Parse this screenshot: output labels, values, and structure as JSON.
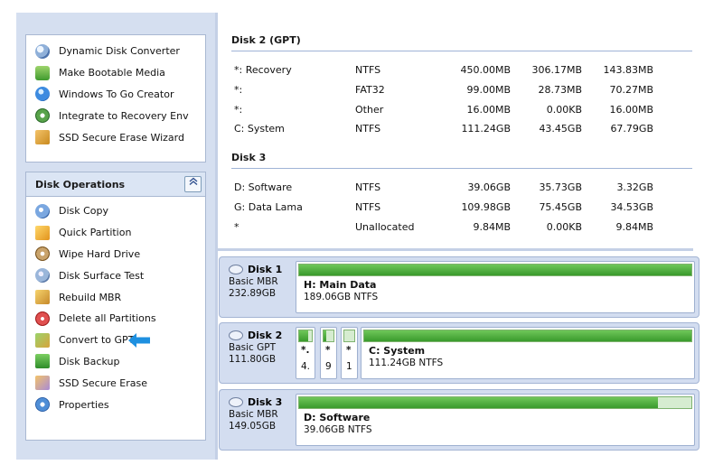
{
  "tools_panel": {
    "items": [
      {
        "label": "Dynamic Disk Converter",
        "icon": "disk-converter-icon"
      },
      {
        "label": "Make Bootable Media",
        "icon": "bootable-media-icon"
      },
      {
        "label": "Windows To Go Creator",
        "icon": "globe-icon"
      },
      {
        "label": "Integrate to Recovery Env",
        "icon": "recovery-gear-icon"
      },
      {
        "label": "SSD Secure Erase Wizard",
        "icon": "ssd-icon"
      }
    ]
  },
  "disk_operations": {
    "title": "Disk Operations",
    "collapse_glyph": "»",
    "items": [
      {
        "label": "Disk Copy",
        "icon": "disk-copy-icon"
      },
      {
        "label": "Quick Partition",
        "icon": "quick-partition-icon"
      },
      {
        "label": "Wipe Hard Drive",
        "icon": "wipe-drive-icon"
      },
      {
        "label": "Disk Surface Test",
        "icon": "surface-test-icon"
      },
      {
        "label": "Rebuild MBR",
        "icon": "rebuild-mbr-icon"
      },
      {
        "label": "Delete all Partitions",
        "icon": "delete-partitions-icon"
      },
      {
        "label": "Convert to GPT",
        "icon": "convert-gpt-icon"
      },
      {
        "label": "Disk Backup",
        "icon": "disk-backup-icon"
      },
      {
        "label": "SSD Secure Erase",
        "icon": "ssd-erase-icon"
      },
      {
        "label": "Properties",
        "icon": "properties-icon"
      }
    ],
    "highlight_arrow_color": "#1e90e0"
  },
  "partition_list": {
    "groups": [
      {
        "title": "Disk 2 (GPT)",
        "rows": [
          {
            "name": "*: Recovery",
            "fs": "NTFS",
            "capacity": "450.00MB",
            "used": "306.17MB",
            "free": "143.83MB"
          },
          {
            "name": "*:",
            "fs": "FAT32",
            "capacity": "99.00MB",
            "used": "28.73MB",
            "free": "70.27MB"
          },
          {
            "name": "*:",
            "fs": "Other",
            "capacity": "16.00MB",
            "used": "0.00KB",
            "free": "16.00MB"
          },
          {
            "name": "C: System",
            "fs": "NTFS",
            "capacity": "111.24GB",
            "used": "43.45GB",
            "free": "67.79GB"
          }
        ]
      },
      {
        "title": "Disk 3",
        "rows": [
          {
            "name": "D: Software",
            "fs": "NTFS",
            "capacity": "39.06GB",
            "used": "35.73GB",
            "free": "3.32GB"
          },
          {
            "name": "G: Data Lama",
            "fs": "NTFS",
            "capacity": "109.98GB",
            "used": "75.45GB",
            "free": "34.53GB"
          },
          {
            "name": "*",
            "fs": "Unallocated",
            "capacity": "9.84MB",
            "used": "0.00KB",
            "free": "9.84MB"
          }
        ]
      }
    ]
  },
  "disk_map": {
    "disks": [
      {
        "name": "Disk 1",
        "type": "Basic MBR",
        "size": "232.89GB",
        "partitions": [
          {
            "title": "H: Main Data",
            "detail": "189.06GB NTFS",
            "fill": 1.0
          }
        ]
      },
      {
        "name": "Disk 2",
        "type": "Basic GPT",
        "size": "111.80GB",
        "partitions": [
          {
            "title": "*.",
            "detail": "4.",
            "fill": 0.68,
            "mini": true
          },
          {
            "title": "*",
            "detail": "9",
            "fill": 0.29,
            "mini": true
          },
          {
            "title": "*",
            "detail": "1",
            "fill": 0.0,
            "mini": true
          },
          {
            "title": "C: System",
            "detail": "111.24GB NTFS",
            "fill": 1.0
          }
        ]
      },
      {
        "name": "Disk 3",
        "type": "Basic MBR",
        "size": "149.05GB",
        "partitions": [
          {
            "title": "D: Software",
            "detail": "39.06GB NTFS",
            "fill": 0.915
          }
        ]
      }
    ]
  }
}
